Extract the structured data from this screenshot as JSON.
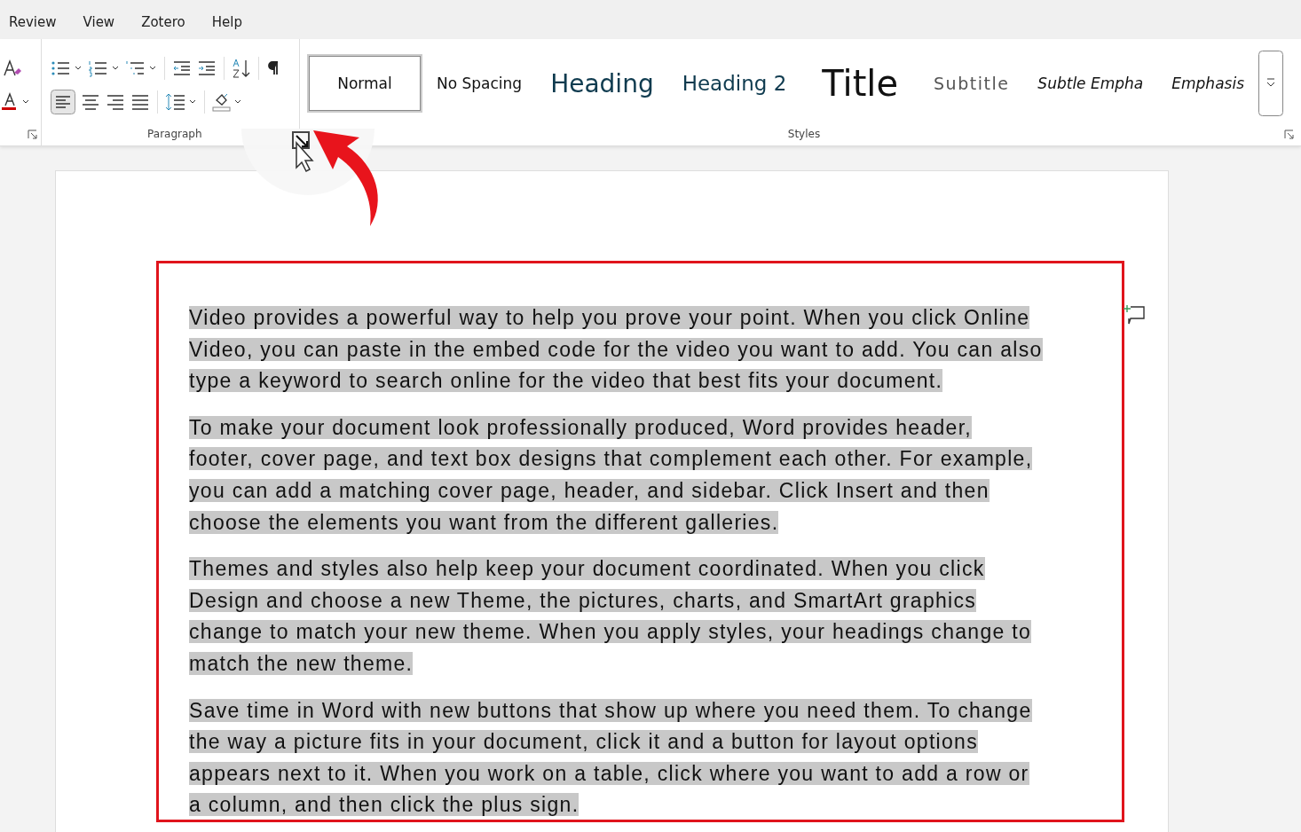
{
  "menu_tabs": [
    {
      "label": "Review"
    },
    {
      "label": "View"
    },
    {
      "label": "Zotero"
    },
    {
      "label": "Help"
    }
  ],
  "ribbon": {
    "paragraph_group": {
      "label": "Paragraph"
    },
    "styles_group": {
      "label": "Styles",
      "styles": [
        {
          "label": "Normal",
          "kind": "normal",
          "selected": true
        },
        {
          "label": "No Spacing",
          "kind": "normal",
          "selected": false
        },
        {
          "label": "Heading",
          "kind": "heading1",
          "selected": false
        },
        {
          "label": "Heading 2",
          "kind": "heading2",
          "selected": false
        },
        {
          "label": "Title",
          "kind": "title",
          "selected": false
        },
        {
          "label": "Subtitle",
          "kind": "subtitle",
          "selected": false
        },
        {
          "label": "Subtle Empha",
          "kind": "emphasis",
          "selected": false
        },
        {
          "label": "Emphasis",
          "kind": "emphasis",
          "selected": false
        }
      ]
    }
  },
  "document": {
    "paragraphs": [
      {
        "text": "Video provides a powerful way to help you prove your point. When you click Online Video, you can paste in the embed code for the video you want to add. You can also type a keyword to search online for the video that best fits your document.",
        "selected": true
      },
      {
        "text": "To make your document look professionally produced, Word provides header, footer, cover page, and text box designs that complement each other. For example, you can add a matching cover page, header, and sidebar. Click Insert and then choose the elements you want from the different galleries.",
        "selected": true
      },
      {
        "text": "Themes and styles also help keep your document coordinated. When you click Design and choose a new Theme, the pictures, charts, and SmartArt graphics change to match your new theme. When you apply styles, your headings change to match the new theme.",
        "selected": true
      },
      {
        "text": "Save time in Word with new buttons that show up where you need them. To change the way a picture fits in your document, click it and a button for layout options appears next to it. When you work on a table, click where you want to add a row or a column, and then click the plus sign.",
        "selected": true
      }
    ]
  }
}
